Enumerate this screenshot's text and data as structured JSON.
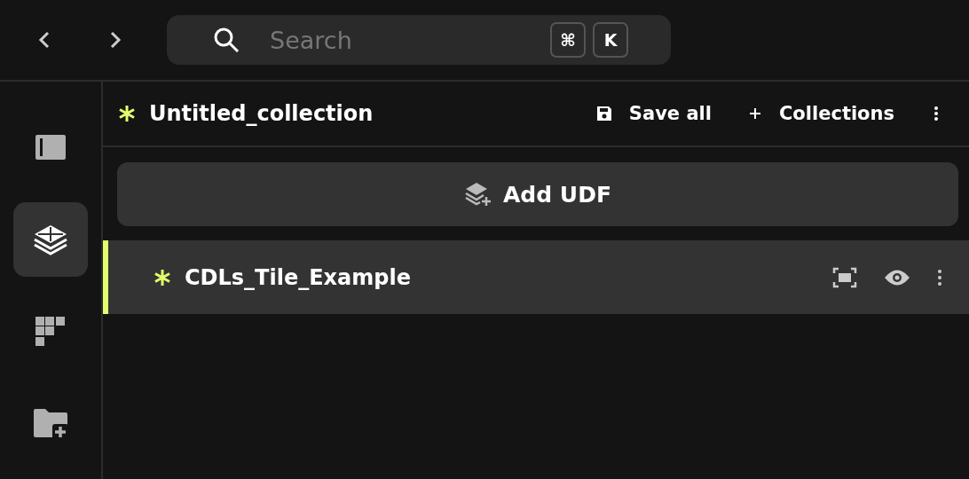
{
  "search": {
    "placeholder": "Search",
    "shortcut_keys": [
      "⌘",
      "K"
    ]
  },
  "sidebar": {
    "items": [
      {
        "kind": "panel",
        "selected": false
      },
      {
        "kind": "layers",
        "selected": true
      },
      {
        "kind": "tiles",
        "selected": false
      },
      {
        "kind": "folder-add",
        "selected": false
      }
    ]
  },
  "collection": {
    "title": "Untitled_collection",
    "unsaved": true,
    "actions": [
      {
        "kind": "save",
        "label": "Save all"
      },
      {
        "kind": "add",
        "label": "Collections"
      }
    ]
  },
  "add_button": {
    "label": "Add UDF"
  },
  "udfs": [
    {
      "name": "CDLs_Tile_Example",
      "unsaved": true,
      "selected": true
    }
  ]
}
